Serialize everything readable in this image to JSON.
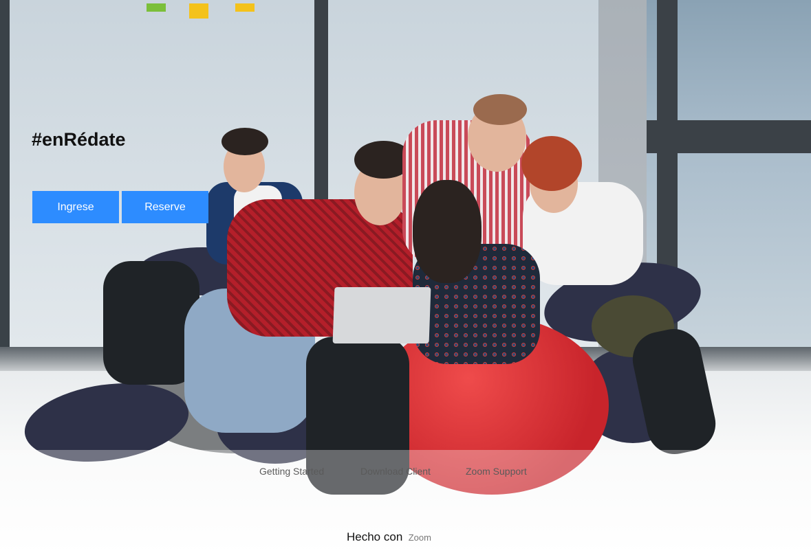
{
  "hero": {
    "title": "#enRédate",
    "image_semantic": "hero-photo-group-on-beanbags"
  },
  "actions": {
    "ingrese_label": "Ingrese",
    "reserve_label": "Reserve"
  },
  "footer": {
    "links": [
      {
        "label": "Getting Started"
      },
      {
        "label": "Download Client"
      },
      {
        "label": "Zoom Support"
      }
    ],
    "credit_text": "Hecho con",
    "credit_link": "Zoom"
  },
  "colors": {
    "accent_button": "#2d8cff",
    "button_text": "#ffffff",
    "title_text": "#111111",
    "footer_link": "#5a5a5a"
  }
}
